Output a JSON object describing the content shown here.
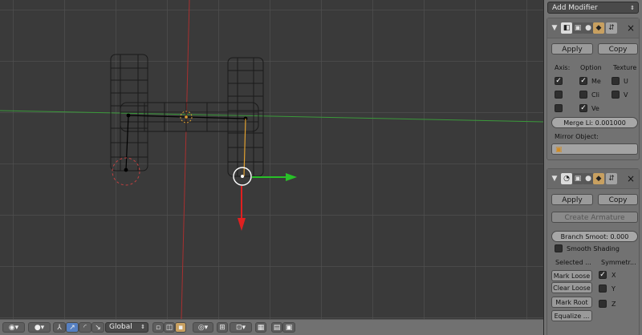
{
  "panel": {
    "add_modifier": "Add Modifier",
    "mirror": {
      "apply": "Apply",
      "copy": "Copy",
      "axis_header": "Axis:",
      "option_header": "Option",
      "texture_header": "Texture",
      "opt_merge": "Me",
      "opt_clip": "Cli",
      "opt_vertex": "Ve",
      "tex_u": "U",
      "tex_v": "V",
      "merge_limit": "Merge Li: 0.001000",
      "mirror_object_label": "Mirror Object:"
    },
    "skin": {
      "apply": "Apply",
      "copy": "Copy",
      "create_armature": "Create Armature",
      "branch_smooth": "Branch Smoot: 0.000",
      "smooth_shading": "Smooth Shading",
      "selected_header": "Selected ...",
      "symmetry_header": "Symmetr...",
      "mark_loose": "Mark Loose",
      "clear_loose": "Clear Loose",
      "mark_root": "Mark Root",
      "equalize": "Equalize ...",
      "sym_x": "X",
      "sym_y": "Y",
      "sym_z": "Z"
    }
  },
  "header": {
    "orientation": "Global"
  },
  "colors": {
    "x_axis": "#c83232",
    "y_axis": "#3cb43c",
    "wire": "#111111",
    "panel_bg": "#737373"
  }
}
